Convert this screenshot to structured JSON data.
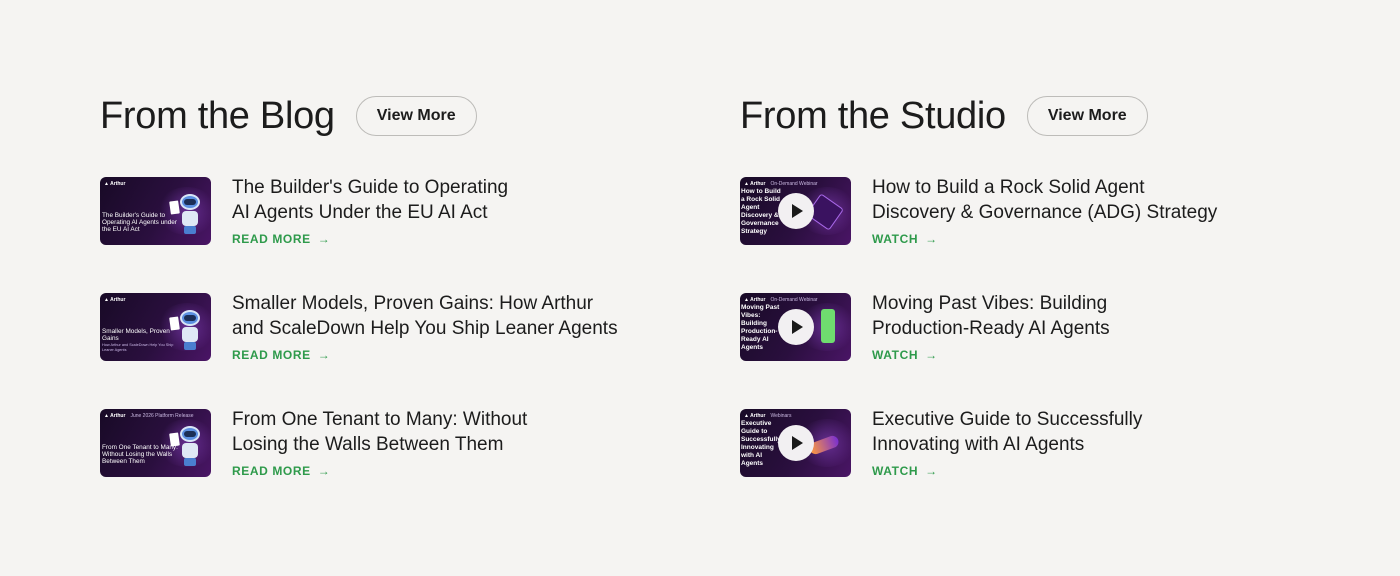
{
  "blog": {
    "heading": "From the Blog",
    "view_more": "View More",
    "cta_label": "READ MORE",
    "items": [
      {
        "title_lines": [
          "The Builder's Guide to Operating",
          "AI Agents Under the EU AI Act"
        ],
        "thumb": {
          "brand": "Arthur",
          "tag": "",
          "text": "The Builder's Guide to Operating AI Agents under the EU AI Act",
          "sub": ""
        }
      },
      {
        "title_lines": [
          "Smaller Models, Proven Gains: How Arthur",
          "and ScaleDown Help You Ship Leaner Agents"
        ],
        "thumb": {
          "brand": "Arthur",
          "tag": "",
          "text": "Smaller Models, Proven Gains",
          "sub": "How Arthur and ScaleDown Help You Ship Leaner Agents"
        }
      },
      {
        "title_lines": [
          "From One Tenant to Many: Without",
          "Losing the Walls Between Them"
        ],
        "thumb": {
          "brand": "Arthur",
          "tag": "June 2026 Platform Release",
          "text": "From One Tenant to Many: Without Losing the Walls Between Them",
          "sub": ""
        }
      }
    ]
  },
  "studio": {
    "heading": "From the Studio",
    "view_more": "View More",
    "cta_label": "WATCH",
    "items": [
      {
        "title_lines": [
          "How to Build a Rock Solid Agent",
          "Discovery & Governance (ADG) Strategy"
        ],
        "thumb": {
          "brand": "Arthur",
          "tag": "On-Demand Webinar",
          "text": "How to Build a Rock Solid Agent Discovery & Governance Strategy"
        }
      },
      {
        "title_lines": [
          "Moving Past Vibes: Building",
          "Production-Ready AI Agents"
        ],
        "thumb": {
          "brand": "Arthur",
          "tag": "On-Demand Webinar",
          "text": "Moving Past Vibes: Building Production-Ready AI Agents"
        }
      },
      {
        "title_lines": [
          "Executive Guide to Successfully",
          "Innovating with AI Agents"
        ],
        "thumb": {
          "brand": "Arthur",
          "tag": "Webinars",
          "text": "Executive Guide to Successfully Innovating with AI Agents"
        }
      }
    ]
  },
  "icons": {
    "cta_arrow": "arrow-right-icon",
    "play": "play-icon",
    "brand": "arthur-logo-icon"
  },
  "colors": {
    "accent_green": "#2e9a4b",
    "background": "#f5f4f2",
    "thumb_purple": "#2a0f3e"
  }
}
